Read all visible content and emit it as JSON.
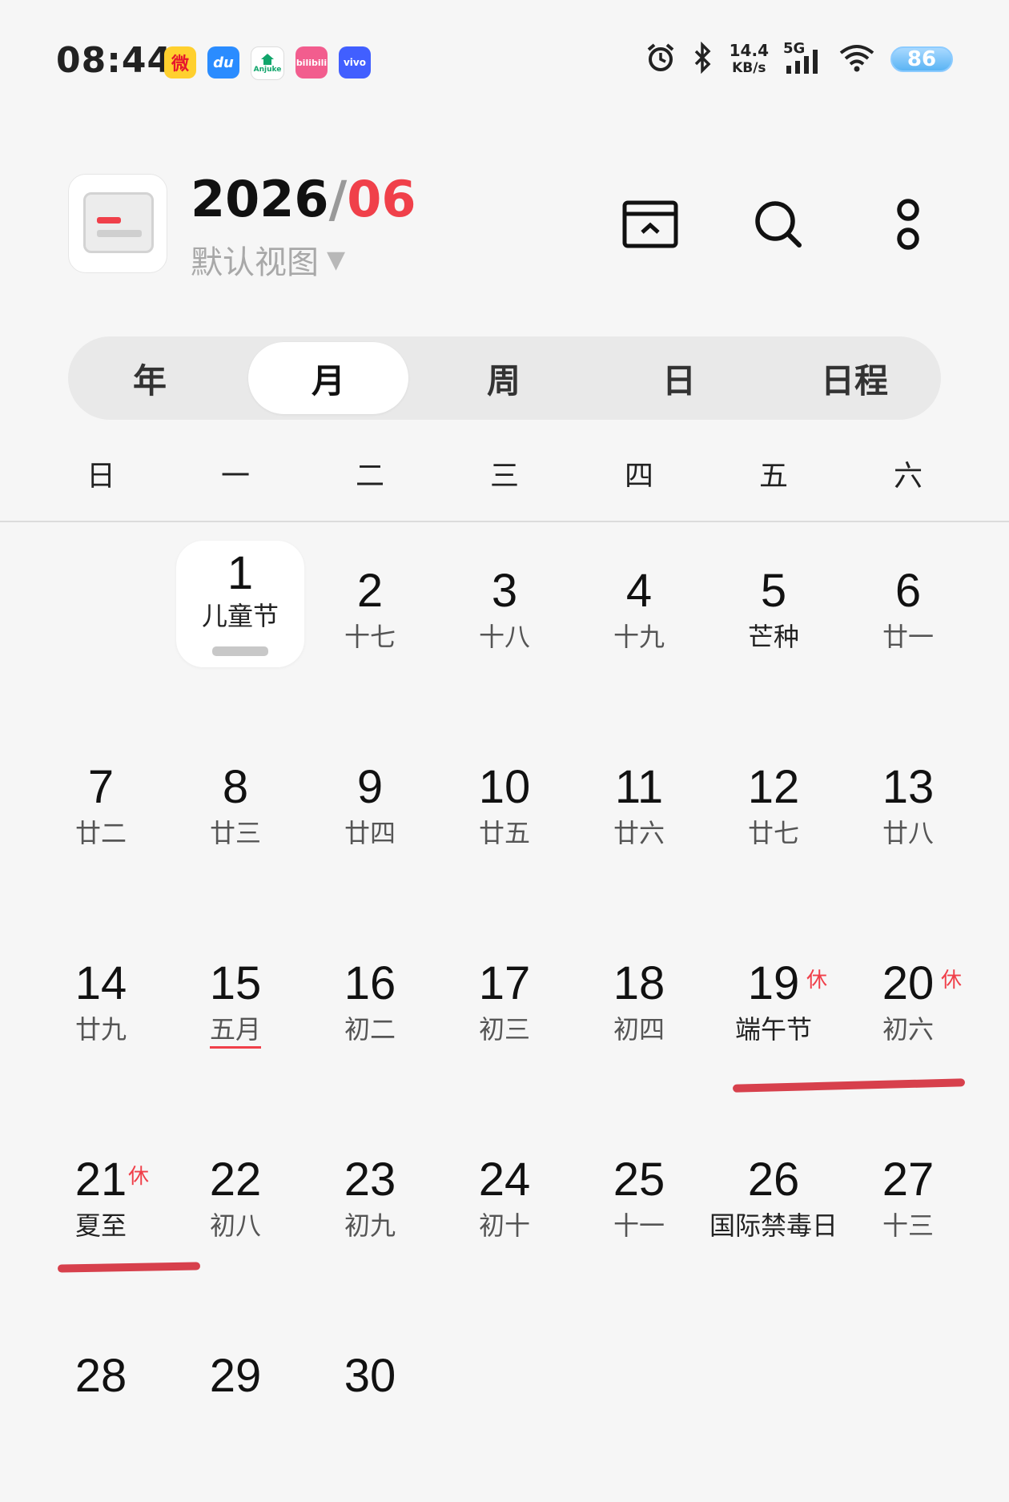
{
  "status_bar": {
    "time": "08:44",
    "apps": [
      {
        "icon": "weibo-icon",
        "label": "微"
      },
      {
        "icon": "du-icon",
        "label": "du"
      },
      {
        "icon": "anjuke-icon",
        "label": "Anjuke"
      },
      {
        "icon": "bilibili-icon",
        "label": "bilibili"
      },
      {
        "icon": "vivo-icon",
        "label": "vivo"
      }
    ],
    "net_speed_value": "14.4",
    "net_speed_unit": "KB/s",
    "network": "5G",
    "battery": "86"
  },
  "header": {
    "year": "2026",
    "separator": "/",
    "month": "06",
    "view_mode": "默认视图",
    "accent_color": "#f0404a"
  },
  "tabs": [
    {
      "label": "年",
      "active": false
    },
    {
      "label": "月",
      "active": true
    },
    {
      "label": "周",
      "active": false
    },
    {
      "label": "日",
      "active": false
    },
    {
      "label": "日程",
      "active": false
    }
  ],
  "weekdays": [
    "日",
    "一",
    "二",
    "三",
    "四",
    "五",
    "六"
  ],
  "weeks": [
    [
      null,
      {
        "day": "1",
        "sub": "儿童节",
        "today": true
      },
      {
        "day": "2",
        "sub": "十七"
      },
      {
        "day": "3",
        "sub": "十八"
      },
      {
        "day": "4",
        "sub": "十九"
      },
      {
        "day": "5",
        "sub": "芒种"
      },
      {
        "day": "6",
        "sub": "廿一"
      }
    ],
    [
      {
        "day": "7",
        "sub": "廿二"
      },
      {
        "day": "8",
        "sub": "廿三"
      },
      {
        "day": "9",
        "sub": "廿四"
      },
      {
        "day": "10",
        "sub": "廿五"
      },
      {
        "day": "11",
        "sub": "廿六"
      },
      {
        "day": "12",
        "sub": "廿七"
      },
      {
        "day": "13",
        "sub": "廿八"
      }
    ],
    [
      {
        "day": "14",
        "sub": "廿九"
      },
      {
        "day": "15",
        "sub": "五月",
        "underline": true
      },
      {
        "day": "16",
        "sub": "初二"
      },
      {
        "day": "17",
        "sub": "初三"
      },
      {
        "day": "18",
        "sub": "初四"
      },
      {
        "day": "19",
        "sub": "端午节",
        "rest": "休",
        "holiday": true
      },
      {
        "day": "20",
        "sub": "初六",
        "rest": "休"
      }
    ],
    [
      {
        "day": "21",
        "sub": "夏至",
        "rest": "休",
        "holiday": true
      },
      {
        "day": "22",
        "sub": "初八"
      },
      {
        "day": "23",
        "sub": "初九"
      },
      {
        "day": "24",
        "sub": "初十"
      },
      {
        "day": "25",
        "sub": "十一"
      },
      {
        "day": "26",
        "sub": "国际禁毒日",
        "holiday": true
      },
      {
        "day": "27",
        "sub": "十三"
      }
    ],
    [
      {
        "day": "28",
        "sub": ""
      },
      {
        "day": "29",
        "sub": ""
      },
      {
        "day": "30",
        "sub": ""
      },
      null,
      null,
      null,
      null
    ]
  ]
}
